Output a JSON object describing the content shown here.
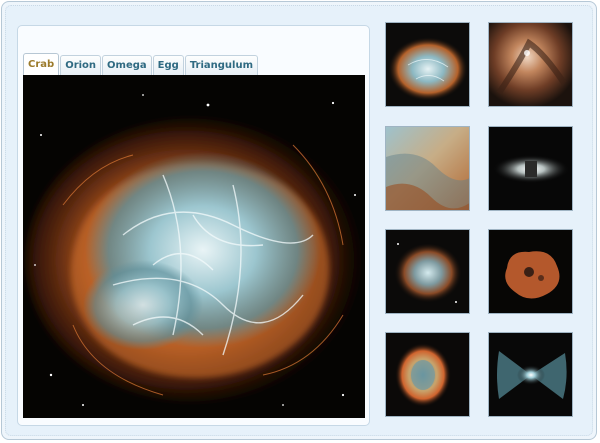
{
  "tabs": [
    {
      "label": "Crab",
      "active": true
    },
    {
      "label": "Orion",
      "active": false
    },
    {
      "label": "Omega",
      "active": false
    },
    {
      "label": "Egg",
      "active": false
    },
    {
      "label": "Triangulum",
      "active": false
    }
  ],
  "main_image": {
    "subject": "crab-nebula"
  },
  "thumbnails": [
    {
      "subject": "crab-nebula"
    },
    {
      "subject": "orion-nebula"
    },
    {
      "subject": "omega-nebula"
    },
    {
      "subject": "egg-nebula"
    },
    {
      "subject": "triangulum-galaxy"
    },
    {
      "subject": "red-nebula"
    },
    {
      "subject": "ring-nebula"
    },
    {
      "subject": "butterfly-nebula"
    }
  ]
}
